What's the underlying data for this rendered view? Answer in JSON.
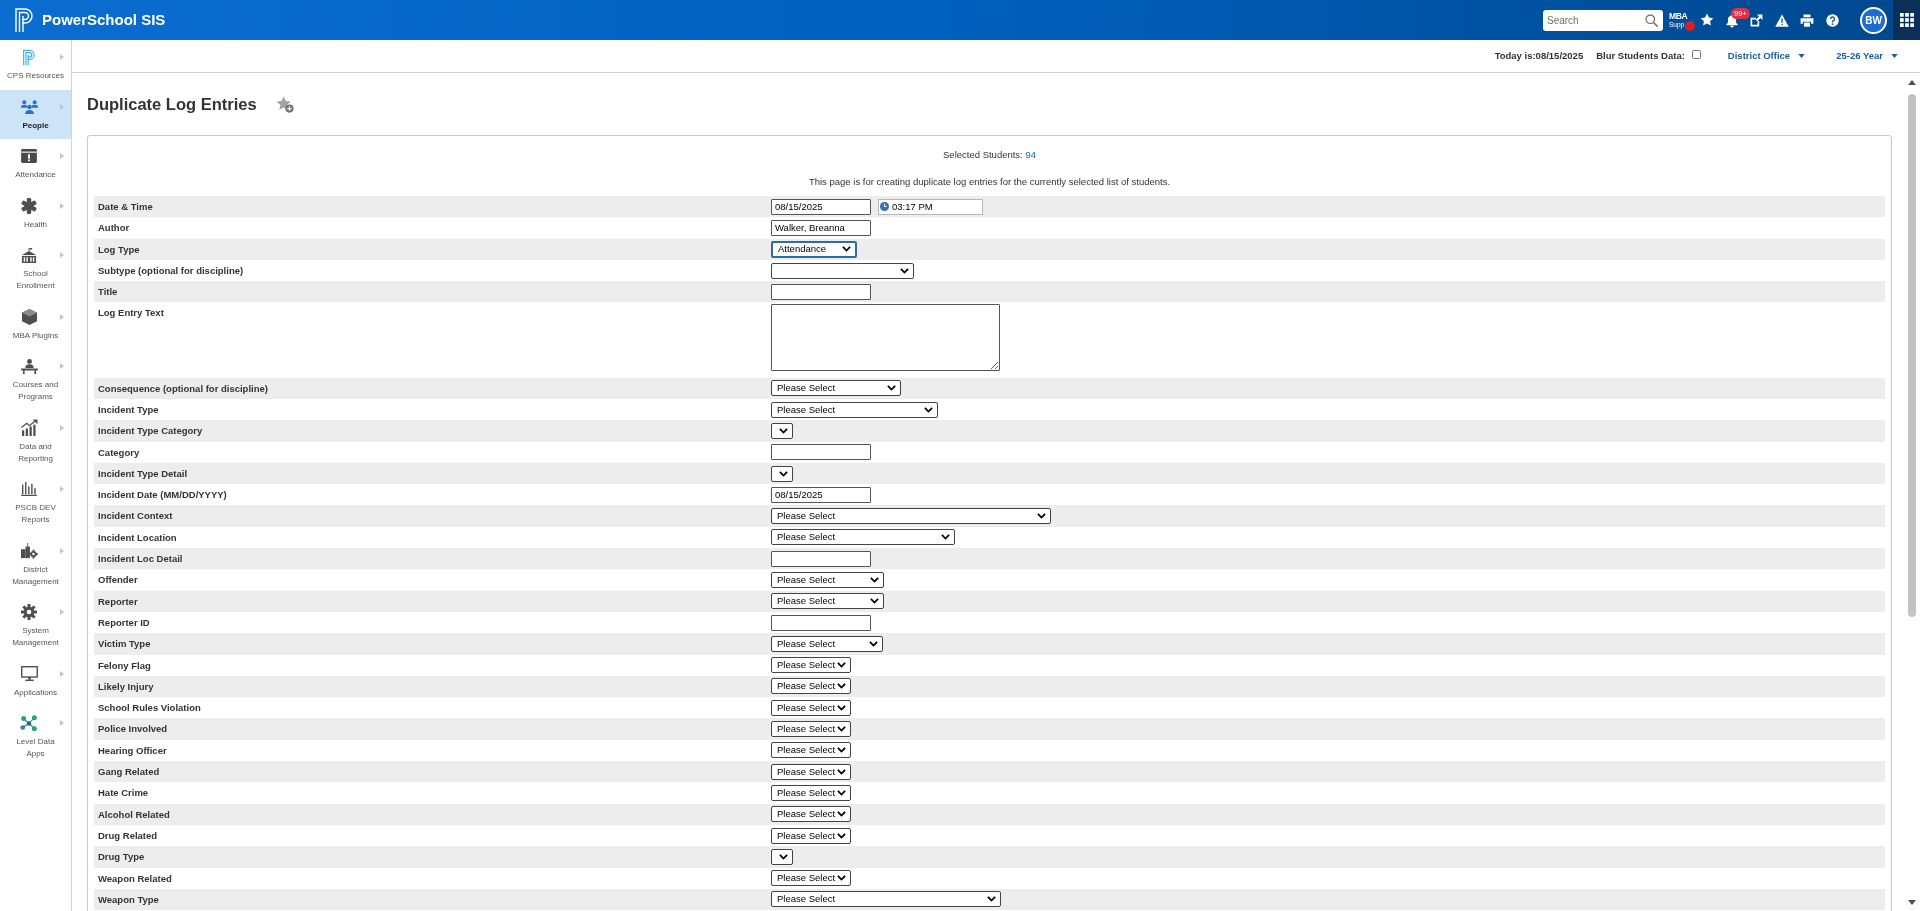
{
  "header": {
    "app_name": "PowerSchool SIS",
    "search": {
      "placeholder": "Search"
    },
    "support": {
      "line_1": "MBA",
      "line_2": "Supp"
    },
    "notifications": {
      "badge": "99+"
    },
    "user": {
      "initials": "BW"
    }
  },
  "info_bar": {
    "date_text": "Today is:08/15/2025",
    "blur_label": "Blur Students Data:",
    "blur_checked": false,
    "district": "District Office",
    "year": "25-26 Year"
  },
  "sidebar": {
    "items": [
      {
        "label": "CPS Resources",
        "selected": false
      },
      {
        "label": "People",
        "selected": true
      },
      {
        "label": "Attendance",
        "selected": false
      },
      {
        "label": "Health",
        "selected": false
      },
      {
        "label": "School Enrollment",
        "selected": false
      },
      {
        "label": "MBA Plugins",
        "selected": false
      },
      {
        "label": "Courses and Programs",
        "selected": false
      },
      {
        "label": "Data and Reporting",
        "selected": false
      },
      {
        "label": "PSCB DEV Reports",
        "selected": false
      },
      {
        "label": "District Management",
        "selected": false
      },
      {
        "label": "System Management",
        "selected": false
      },
      {
        "label": "Applications",
        "selected": false
      },
      {
        "label": "Level Data Apps",
        "selected": false
      }
    ]
  },
  "page": {
    "title": "Duplicate Log Entries"
  },
  "form": {
    "selected_students": {
      "label": "Selected Students:",
      "count": "94"
    },
    "intro": "This page is for creating duplicate log entries for the currently selected list of students.",
    "rows": [
      {
        "label": "Date & Time",
        "field": {
          "kind": "datetime",
          "date": "08/15/2025",
          "time": "03:17 PM",
          "focused": false
        }
      },
      {
        "label": "Author",
        "field": {
          "kind": "text",
          "value": "Walker, Breanna",
          "focused": false
        }
      },
      {
        "label": "Log Type",
        "field": {
          "kind": "select",
          "value": "Attendance",
          "focused": true
        }
      },
      {
        "label": "Subtype (optional for discipline)",
        "field": {
          "kind": "select",
          "focused": false
        }
      },
      {
        "label": "Title",
        "field": {
          "kind": "text",
          "focused": false
        }
      },
      {
        "label": "Log Entry Text",
        "field": {
          "kind": "textarea",
          "focused": false
        }
      },
      {
        "label": "Consequence (optional for discipline)",
        "field": {
          "kind": "select",
          "value": "Please Select",
          "focused": false
        }
      },
      {
        "label": "Incident Type",
        "field": {
          "kind": "select",
          "value": "Please Select",
          "focused": false
        }
      },
      {
        "label": "Incident Type Category",
        "field": {
          "kind": "select",
          "focused": false
        }
      },
      {
        "label": "Category",
        "field": {
          "kind": "text",
          "focused": false
        }
      },
      {
        "label": "Incident Type Detail",
        "field": {
          "kind": "select",
          "focused": false
        }
      },
      {
        "label": "Incident Date (MM/DD/YYYY)",
        "field": {
          "kind": "text",
          "value": "08/15/2025",
          "focused": false
        }
      },
      {
        "label": "Incident Context",
        "field": {
          "kind": "select",
          "value": "Please Select",
          "focused": false
        }
      },
      {
        "label": "Incident Location",
        "field": {
          "kind": "select",
          "value": "Please Select",
          "focused": false
        }
      },
      {
        "label": "Incident Loc Detail",
        "field": {
          "kind": "text",
          "focused": false
        }
      },
      {
        "label": "Offender",
        "field": {
          "kind": "select",
          "value": "Please Select",
          "focused": false
        }
      },
      {
        "label": "Reporter",
        "field": {
          "kind": "select",
          "value": "Please Select",
          "focused": false
        }
      },
      {
        "label": "Reporter ID",
        "field": {
          "kind": "text",
          "focused": false
        }
      },
      {
        "label": "Victim Type",
        "field": {
          "kind": "select",
          "value": "Please Select",
          "focused": false
        }
      },
      {
        "label": "Felony Flag",
        "field": {
          "kind": "select",
          "value": "Please Select",
          "focused": false
        }
      },
      {
        "label": "Likely Injury",
        "field": {
          "kind": "select",
          "value": "Please Select",
          "focused": false
        }
      },
      {
        "label": "School Rules Violation",
        "field": {
          "kind": "select",
          "value": "Please Select",
          "focused": false
        }
      },
      {
        "label": "Police Involved",
        "field": {
          "kind": "select",
          "value": "Please Select",
          "focused": false
        }
      },
      {
        "label": "Hearing Officer",
        "field": {
          "kind": "select",
          "value": "Please Select",
          "focused": false
        }
      },
      {
        "label": "Gang Related",
        "field": {
          "kind": "select",
          "value": "Please Select",
          "focused": false
        }
      },
      {
        "label": "Hate Crime",
        "field": {
          "kind": "select",
          "value": "Please Select",
          "focused": false
        }
      },
      {
        "label": "Alcohol Related",
        "field": {
          "kind": "select",
          "value": "Please Select",
          "focused": false
        }
      },
      {
        "label": "Drug Related",
        "field": {
          "kind": "select",
          "value": "Please Select",
          "focused": false
        }
      },
      {
        "label": "Drug Type",
        "field": {
          "kind": "select",
          "focused": false
        }
      },
      {
        "label": "Weapon Related",
        "field": {
          "kind": "select",
          "value": "Please Select",
          "focused": false
        }
      },
      {
        "label": "Weapon Type",
        "field": {
          "kind": "select",
          "value": "Please Select",
          "focused": false
        }
      }
    ]
  }
}
